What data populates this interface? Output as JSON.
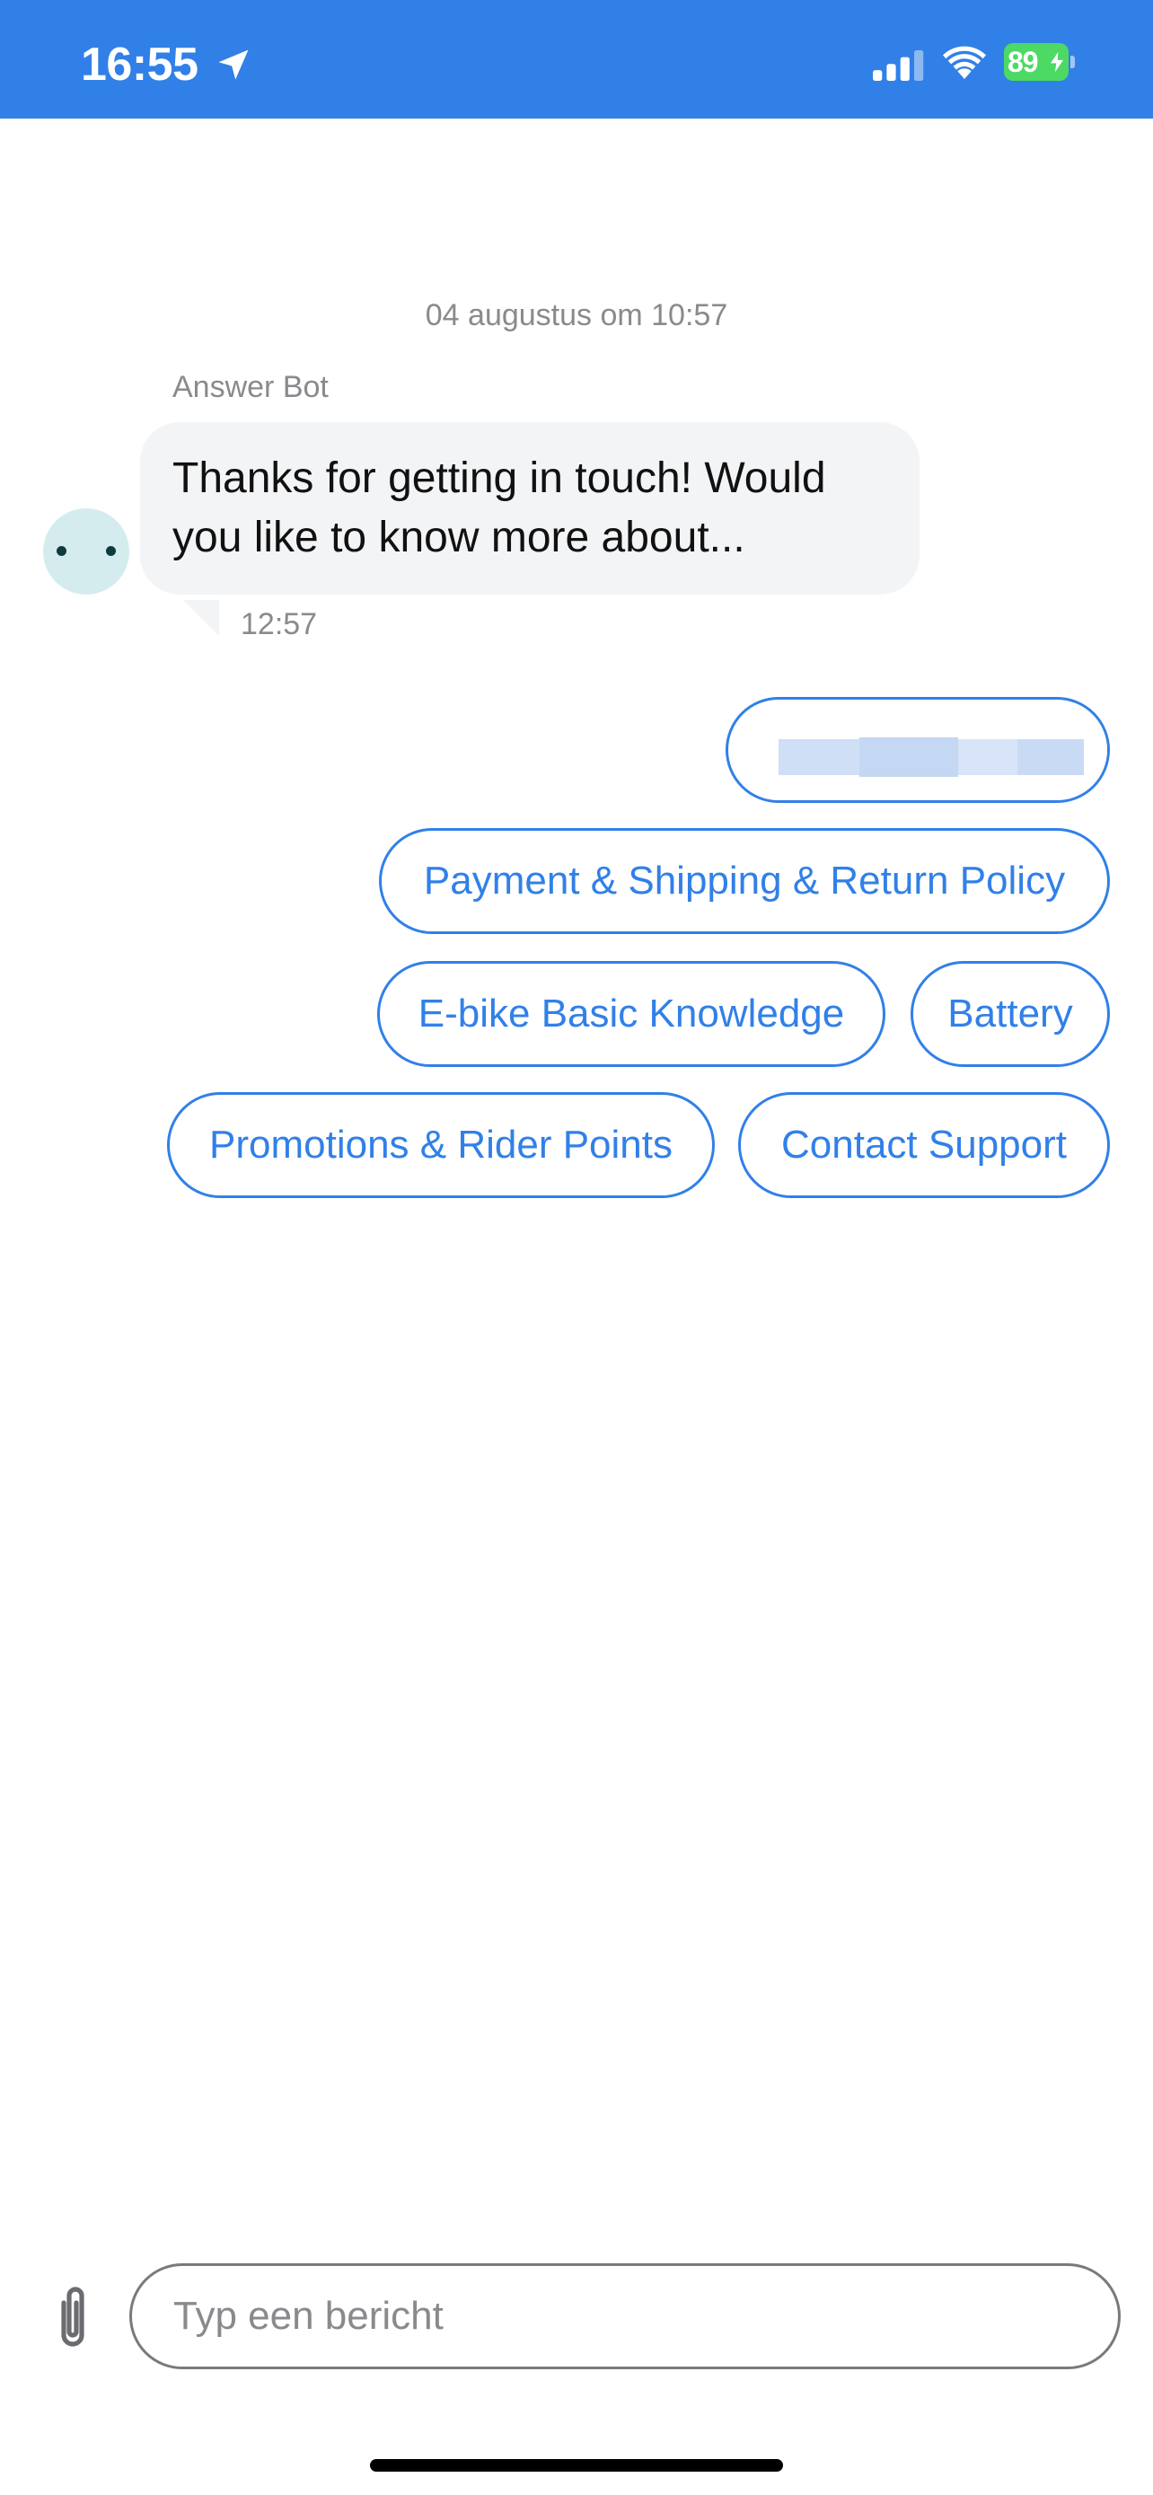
{
  "status_bar": {
    "time": "16:55",
    "battery": "89",
    "bg_color": "#3180e8",
    "icons": [
      "location-arrow-icon",
      "cellular-signal-icon",
      "wifi-icon",
      "battery-charging-icon"
    ]
  },
  "chat": {
    "date_stamp": "04 augustus om 10:57",
    "sender": "Answer Bot",
    "message": "Thanks for getting in touch! Would you like to know more about...",
    "message_time": "12:57"
  },
  "quick_replies": [
    "Payment & Shipping & Return Policy",
    "E-bike Basic Knowledge",
    "Battery",
    "Promotions & Rider Points",
    "Contact Support"
  ],
  "composer": {
    "placeholder": "Typ een bericht",
    "attach_icon": "paperclip-icon"
  },
  "colors": {
    "accent": "#3180e8",
    "bubble": "#f3f4f6",
    "muted_text": "#8a8a8e"
  }
}
